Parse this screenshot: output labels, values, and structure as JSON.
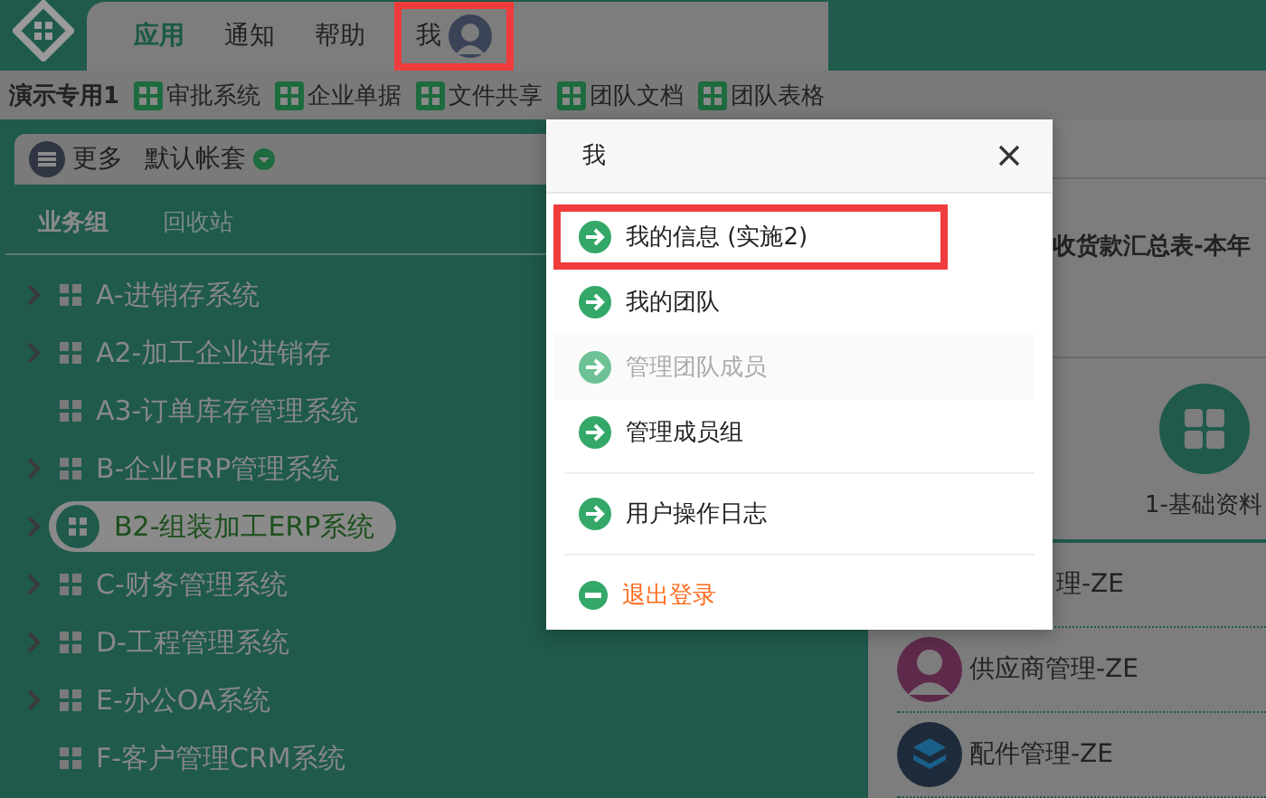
{
  "top_nav": [
    {
      "label": "应用",
      "kind": "link",
      "selected": true,
      "highlighted": false
    },
    {
      "label": "通知",
      "kind": "link",
      "selected": false,
      "highlighted": false
    },
    {
      "label": "帮助",
      "kind": "link",
      "selected": false,
      "highlighted": false
    },
    {
      "label": "我",
      "kind": "user",
      "selected": false,
      "highlighted": true
    }
  ],
  "toolbar": {
    "title": "演示专用1",
    "items": [
      "审批系统",
      "企业单据",
      "文件共享",
      "团队文档",
      "团队表格"
    ]
  },
  "panel": {
    "more": "更多",
    "account": "默认帐套",
    "tabs": [
      {
        "label": "业务组",
        "selected": true
      },
      {
        "label": "回收站",
        "selected": false
      }
    ],
    "tree": [
      {
        "label": "A-进销存系统",
        "expandable": true,
        "selected": false
      },
      {
        "label": "A2-加工企业进销存",
        "expandable": true,
        "selected": false
      },
      {
        "label": "A3-订单库存管理系统",
        "expandable": false,
        "selected": false
      },
      {
        "label": "B-企业ERP管理系统",
        "expandable": true,
        "selected": false
      },
      {
        "label": "B2-组装加工ERP系统",
        "expandable": true,
        "selected": true
      },
      {
        "label": "C-财务管理系统",
        "expandable": true,
        "selected": false
      },
      {
        "label": "D-工程管理系统",
        "expandable": true,
        "selected": false
      },
      {
        "label": "E-办公OA系统",
        "expandable": true,
        "selected": false
      },
      {
        "label": "F-客户管理CRM系统",
        "expandable": false,
        "selected": false
      }
    ]
  },
  "content": {
    "report_title": "收货款汇总表-本年",
    "tile": "1-基础资料",
    "list": [
      {
        "label": "理-ZE",
        "kind": "none"
      },
      {
        "label": "供应商管理-ZE",
        "kind": "person"
      },
      {
        "label": "配件管理-ZE",
        "kind": "layers"
      }
    ]
  },
  "dialog": {
    "title": "我",
    "items": [
      {
        "label": "我的信息 (实施2)",
        "kind": "link",
        "disabled": false,
        "highlighted": true,
        "divider_before": false
      },
      {
        "label": "我的团队",
        "kind": "link",
        "disabled": false,
        "highlighted": false,
        "divider_before": false
      },
      {
        "label": "管理团队成员",
        "kind": "link",
        "disabled": true,
        "highlighted": false,
        "divider_before": false
      },
      {
        "label": "管理成员组",
        "kind": "link",
        "disabled": false,
        "highlighted": false,
        "divider_before": false
      },
      {
        "label": "用户操作日志",
        "kind": "link",
        "disabled": false,
        "highlighted": false,
        "divider_before": true
      },
      {
        "label": "退出登录",
        "kind": "logout",
        "disabled": false,
        "highlighted": false,
        "divider_before": true
      }
    ]
  }
}
